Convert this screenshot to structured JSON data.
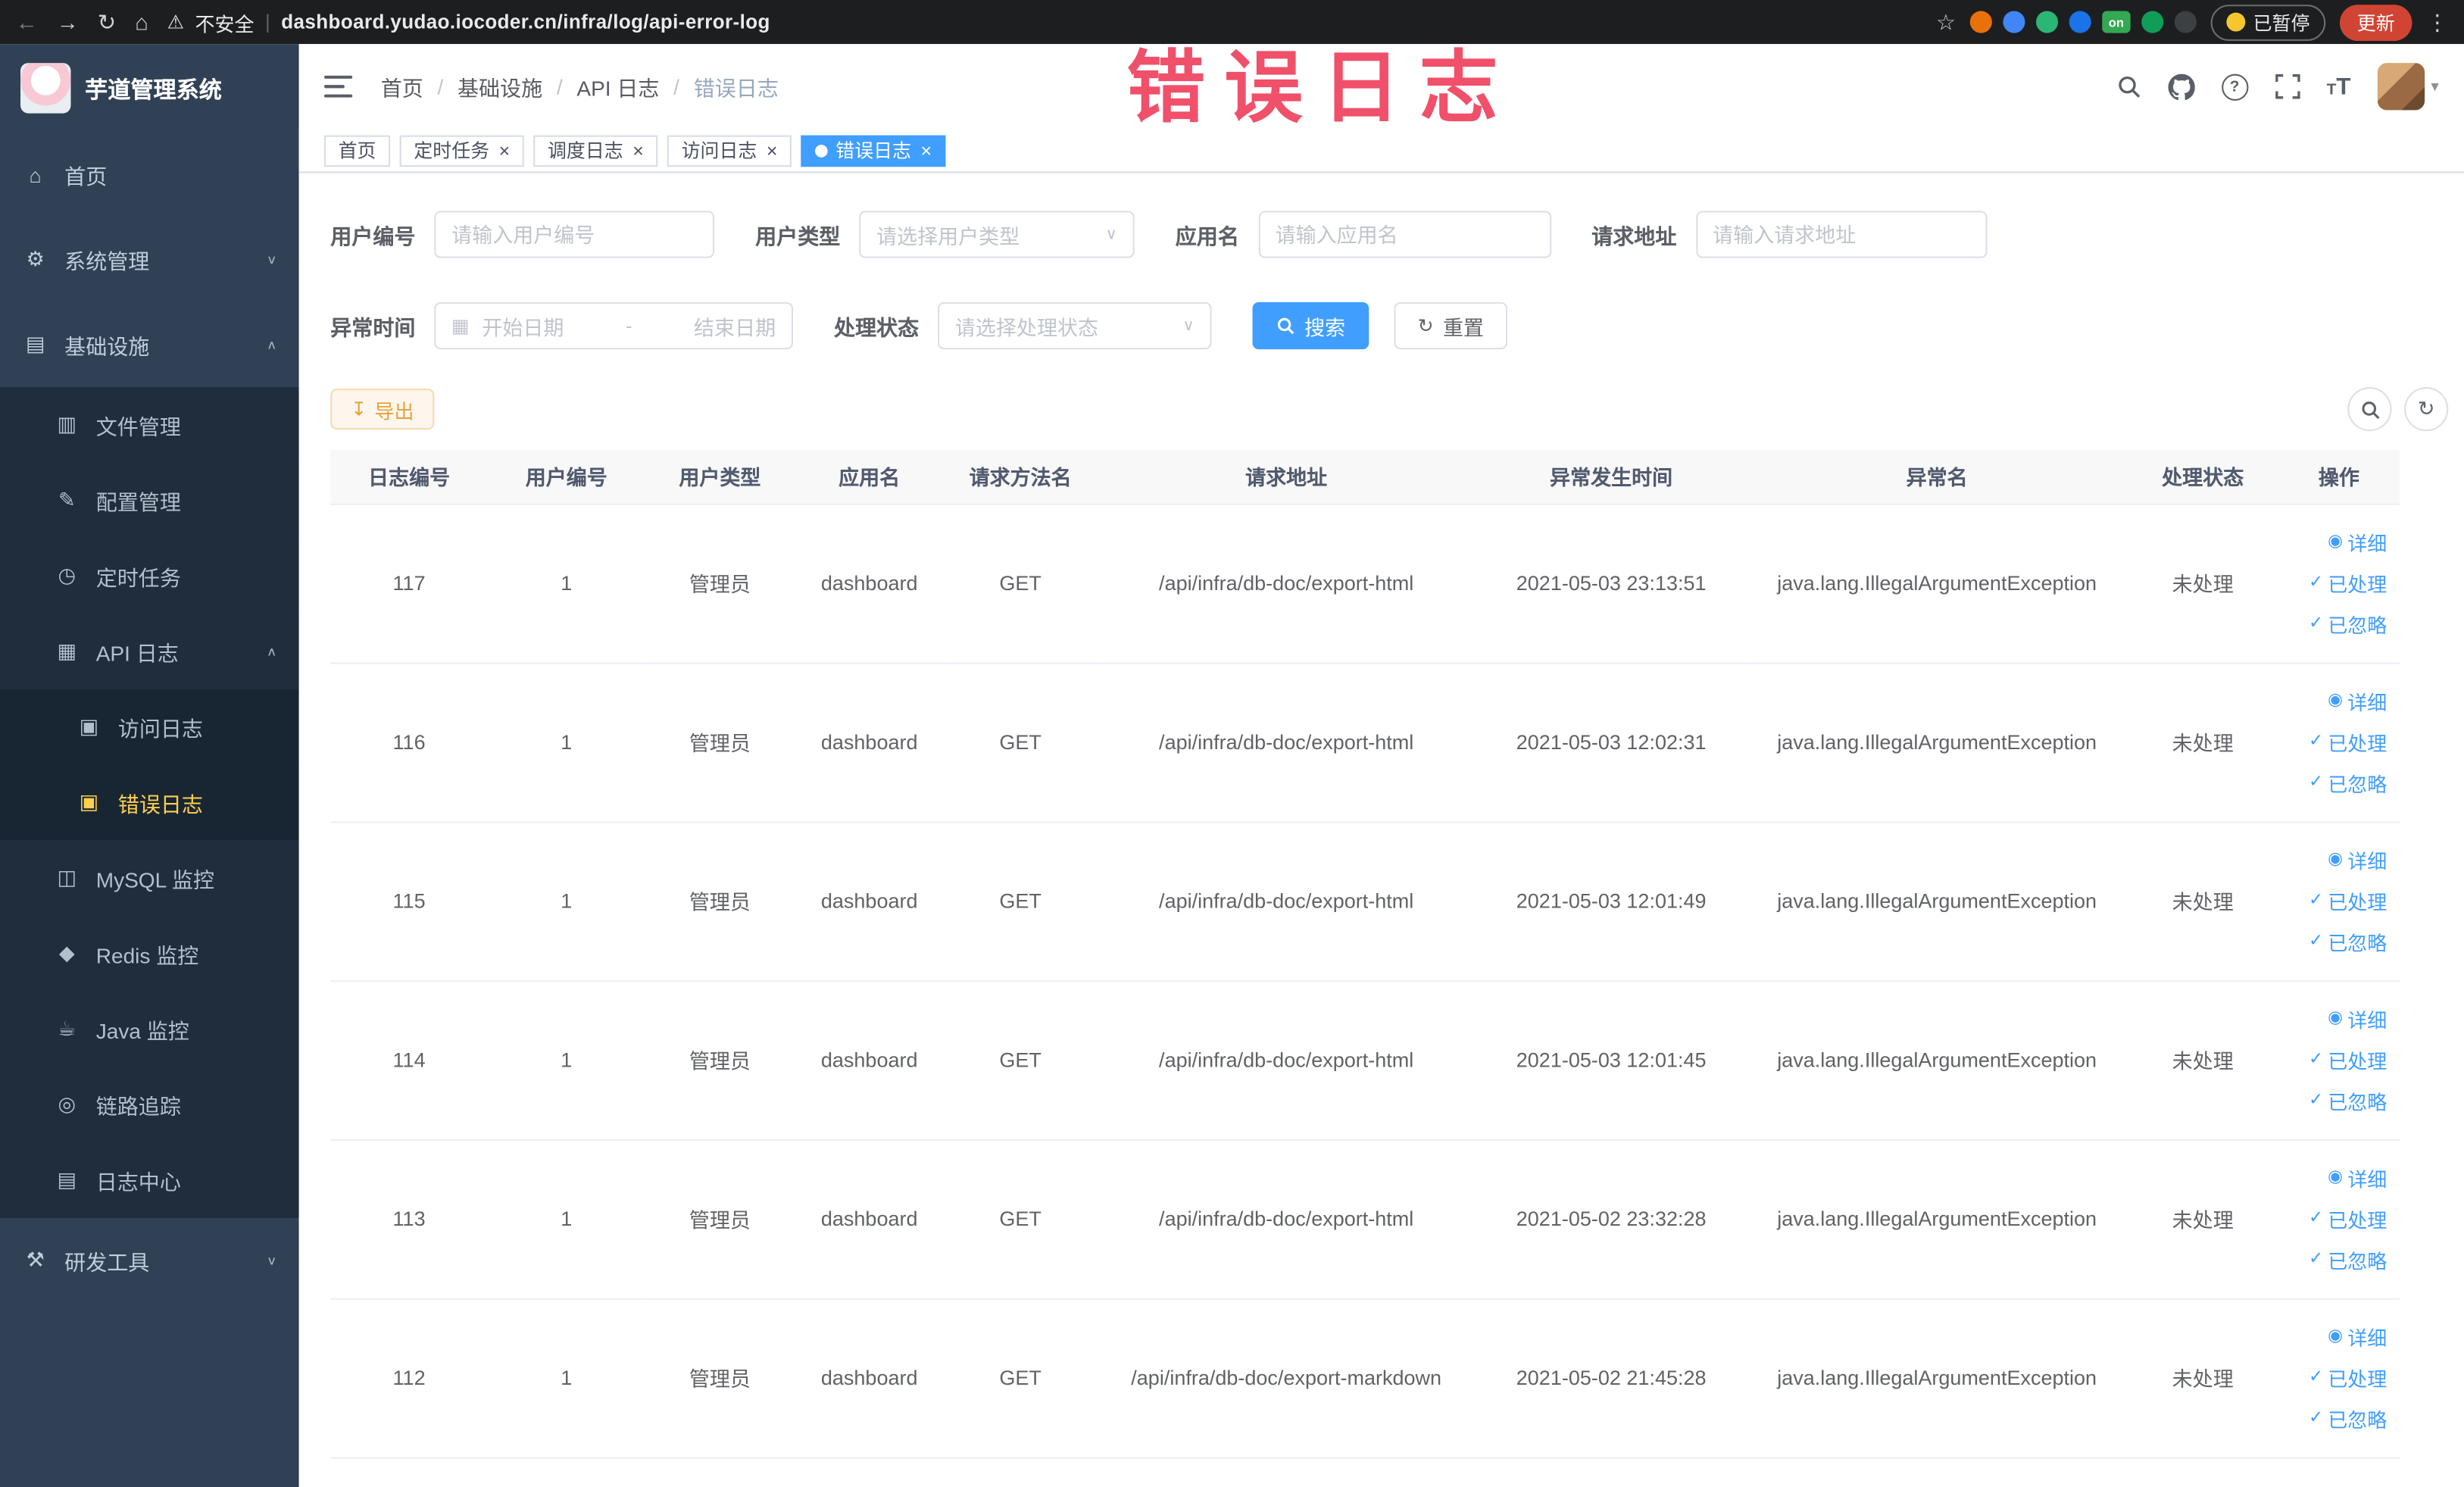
{
  "colors": {
    "accent": "#409eff",
    "menu_active_text": "#ffd04b",
    "annotation": "#f0506a",
    "warning_button": "#e6a23c"
  },
  "annotation": {
    "text": "错误日志"
  },
  "browser": {
    "security_label": "不安全",
    "url": "dashboard.yudao.iocoder.cn/infra/log/api-error-log",
    "paused_label": "已暂停",
    "update_label": "更新",
    "extensions": [
      {
        "name": "orange-circle-ext-icon",
        "color": "#e8710a"
      },
      {
        "name": "water-drop-ext-icon",
        "color": "#4285f4"
      },
      {
        "name": "green-circle-ext-icon",
        "color": "#2bb673"
      },
      {
        "name": "blue-grid-ext-icon",
        "color": "#1a73e8"
      },
      {
        "name": "on-badge-ext-icon",
        "color": "#34a853",
        "text": "on"
      },
      {
        "name": "leaf-ext-icon",
        "color": "#0f9d58"
      },
      {
        "name": "paw-ext-icon",
        "color": "#3c4043"
      }
    ]
  },
  "sidebar": {
    "logo_title": "芋道管理系统",
    "items": [
      {
        "key": "home",
        "label": "首页",
        "icon": "home-icon",
        "level": 1
      },
      {
        "key": "system",
        "label": "系统管理",
        "icon": "gear-icon",
        "level": 1,
        "arrow": "down"
      },
      {
        "key": "infra",
        "label": "基础设施",
        "icon": "infra-icon",
        "level": 1,
        "arrow": "up"
      },
      {
        "key": "file",
        "label": "文件管理",
        "icon": "folder-icon",
        "level": 2
      },
      {
        "key": "config",
        "label": "配置管理",
        "icon": "edit-icon",
        "level": 2
      },
      {
        "key": "job",
        "label": "定时任务",
        "icon": "clock-icon",
        "level": 2
      },
      {
        "key": "api-log",
        "label": "API 日志",
        "icon": "api-log-icon",
        "level": 2,
        "arrow": "up"
      },
      {
        "key": "access-log",
        "label": "访问日志",
        "icon": "log-doc-icon",
        "level": 3
      },
      {
        "key": "error-log",
        "label": "错误日志",
        "icon": "log-doc-icon",
        "level": 3,
        "active": true
      },
      {
        "key": "mysql",
        "label": "MySQL 监控",
        "icon": "mysql-icon",
        "level": 2
      },
      {
        "key": "redis",
        "label": "Redis 监控",
        "icon": "redis-icon",
        "level": 2
      },
      {
        "key": "java",
        "label": "Java 监控",
        "icon": "java-icon",
        "level": 2
      },
      {
        "key": "trace",
        "label": "链路追踪",
        "icon": "trace-icon",
        "level": 2
      },
      {
        "key": "log-center",
        "label": "日志中心",
        "icon": "log-center-icon",
        "level": 2
      },
      {
        "key": "dev-tools",
        "label": "研发工具",
        "icon": "tool-icon",
        "level": 1,
        "arrow": "down"
      }
    ]
  },
  "header": {
    "breadcrumb": [
      "首页",
      "基础设施",
      "API 日志",
      "错误日志"
    ]
  },
  "tabs": [
    {
      "key": "home",
      "label": "首页",
      "closable": false,
      "active": false
    },
    {
      "key": "job",
      "label": "定时任务",
      "closable": true,
      "active": false
    },
    {
      "key": "job-log",
      "label": "调度日志",
      "closable": true,
      "active": false
    },
    {
      "key": "access-log",
      "label": "访问日志",
      "closable": true,
      "active": false
    },
    {
      "key": "error-log",
      "label": "错误日志",
      "closable": true,
      "active": true
    }
  ],
  "filters": {
    "user_id": {
      "label": "用户编号",
      "placeholder": "请输入用户编号"
    },
    "user_type": {
      "label": "用户类型",
      "placeholder": "请选择用户类型"
    },
    "app_name": {
      "label": "应用名",
      "placeholder": "请输入应用名"
    },
    "request_url": {
      "label": "请求地址",
      "placeholder": "请输入请求地址"
    },
    "exception_time": {
      "label": "异常时间",
      "start_placeholder": "开始日期",
      "end_placeholder": "结束日期",
      "separator": "-"
    },
    "process_status": {
      "label": "处理状态",
      "placeholder": "请选择处理状态"
    },
    "search_label": "搜索",
    "reset_label": "重置"
  },
  "toolbar": {
    "export_label": "导出"
  },
  "table": {
    "columns": [
      "日志编号",
      "用户编号",
      "用户类型",
      "应用名",
      "请求方法名",
      "请求地址",
      "异常发生时间",
      "异常名",
      "处理状态",
      "操作"
    ],
    "col_keys": [
      "id",
      "user_id",
      "user_type",
      "app",
      "method",
      "url",
      "time",
      "exception",
      "status"
    ],
    "row_actions": [
      {
        "key": "detail",
        "label": "详细",
        "icon": "eye-icon"
      },
      {
        "key": "processed",
        "label": "已处理",
        "icon": "check-icon"
      },
      {
        "key": "ignored",
        "label": "已忽略",
        "icon": "check-icon"
      }
    ],
    "rows": [
      {
        "id": "117",
        "user_id": "1",
        "user_type": "管理员",
        "app": "dashboard",
        "method": "GET",
        "url": "/api/infra/db-doc/export-html",
        "time": "2021-05-03 23:13:51",
        "exception": "java.lang.IllegalArgumentException",
        "status": "未处理"
      },
      {
        "id": "116",
        "user_id": "1",
        "user_type": "管理员",
        "app": "dashboard",
        "method": "GET",
        "url": "/api/infra/db-doc/export-html",
        "time": "2021-05-03 12:02:31",
        "exception": "java.lang.IllegalArgumentException",
        "status": "未处理"
      },
      {
        "id": "115",
        "user_id": "1",
        "user_type": "管理员",
        "app": "dashboard",
        "method": "GET",
        "url": "/api/infra/db-doc/export-html",
        "time": "2021-05-03 12:01:49",
        "exception": "java.lang.IllegalArgumentException",
        "status": "未处理"
      },
      {
        "id": "114",
        "user_id": "1",
        "user_type": "管理员",
        "app": "dashboard",
        "method": "GET",
        "url": "/api/infra/db-doc/export-html",
        "time": "2021-05-03 12:01:45",
        "exception": "java.lang.IllegalArgumentException",
        "status": "未处理"
      },
      {
        "id": "113",
        "user_id": "1",
        "user_type": "管理员",
        "app": "dashboard",
        "method": "GET",
        "url": "/api/infra/db-doc/export-html",
        "time": "2021-05-02 23:32:28",
        "exception": "java.lang.IllegalArgumentException",
        "status": "未处理"
      },
      {
        "id": "112",
        "user_id": "1",
        "user_type": "管理员",
        "app": "dashboard",
        "method": "GET",
        "url": "/api/infra/db-doc/export-markdown",
        "time": "2021-05-02 21:45:28",
        "exception": "java.lang.IllegalArgumentException",
        "status": "未处理"
      }
    ]
  }
}
